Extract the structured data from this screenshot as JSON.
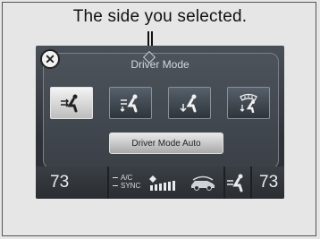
{
  "caption": "The side you selected.",
  "screen": {
    "title": "Driver Mode",
    "modes": [
      {
        "icon": "face-vent-icon",
        "selected": true
      },
      {
        "icon": "face-feet-vent-icon",
        "selected": false
      },
      {
        "icon": "feet-vent-icon",
        "selected": false
      },
      {
        "icon": "defrost-feet-icon",
        "selected": false
      }
    ],
    "auto_button_label": "Driver Mode Auto",
    "close_glyph": "✕",
    "bottom": {
      "left_temp": "73",
      "ac_label": "A/C",
      "sync_label": "SYNC",
      "right_temp": "73"
    }
  },
  "colors": {
    "screen_bg": "#2f3339",
    "selected_bg": "#f4f4f4",
    "text_light": "#e9ecef"
  }
}
